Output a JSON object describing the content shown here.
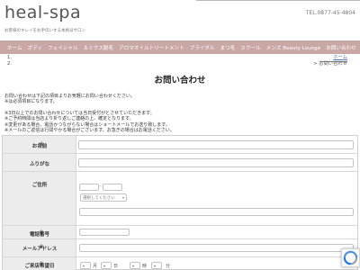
{
  "header": {
    "logo": "heal-spa",
    "tagline": "お客様のキレイをお手伝いする本格派サロン",
    "tel": "TEL.0877-45-4804"
  },
  "nav": {
    "items": [
      "ホーム",
      "ボディ",
      "フェイシャル",
      "＆ミクス脱毛",
      "アロマオイルトリートメント",
      "ブライダル",
      "まつ毛",
      "スクール",
      "メンズ Beauty Lounge",
      "お問い合わせ"
    ]
  },
  "breadcrumb": {
    "left": [
      "1.",
      "2."
    ],
    "home": "ホーム",
    "current": "> お問い合わせ"
  },
  "page": {
    "title": "お問い合わせ"
  },
  "notes": {
    "lines": [
      "お問い合わせは下記の項目よりお気軽にお問い合わせください。",
      "※は必須項目になります。",
      "※3日以上でのお問い合わせについては当日受付がとさせていただきます。",
      "※ご予約時間は当店より折り返しご連絡の上、確定となります。",
      "※変更がある場合、電話かつながらない場合はショートメールでお送り致します。",
      "※メールのご返信は行間やかる場合がございます。お急ぎの場合はお電話ください。"
    ]
  },
  "form": {
    "required_mark": "※",
    "name_label": "お名前",
    "kana_label": "ふりがな",
    "address_label": "ご住所",
    "postal_dash": "-",
    "prefecture_placeholder": "選択してください",
    "phone_label": "電話番号",
    "email_label": "メールアドレス",
    "date_label": "ご来店希望日",
    "month_unit": "月",
    "day_unit": "日",
    "hour_unit": "時",
    "minute_unit": "分"
  }
}
